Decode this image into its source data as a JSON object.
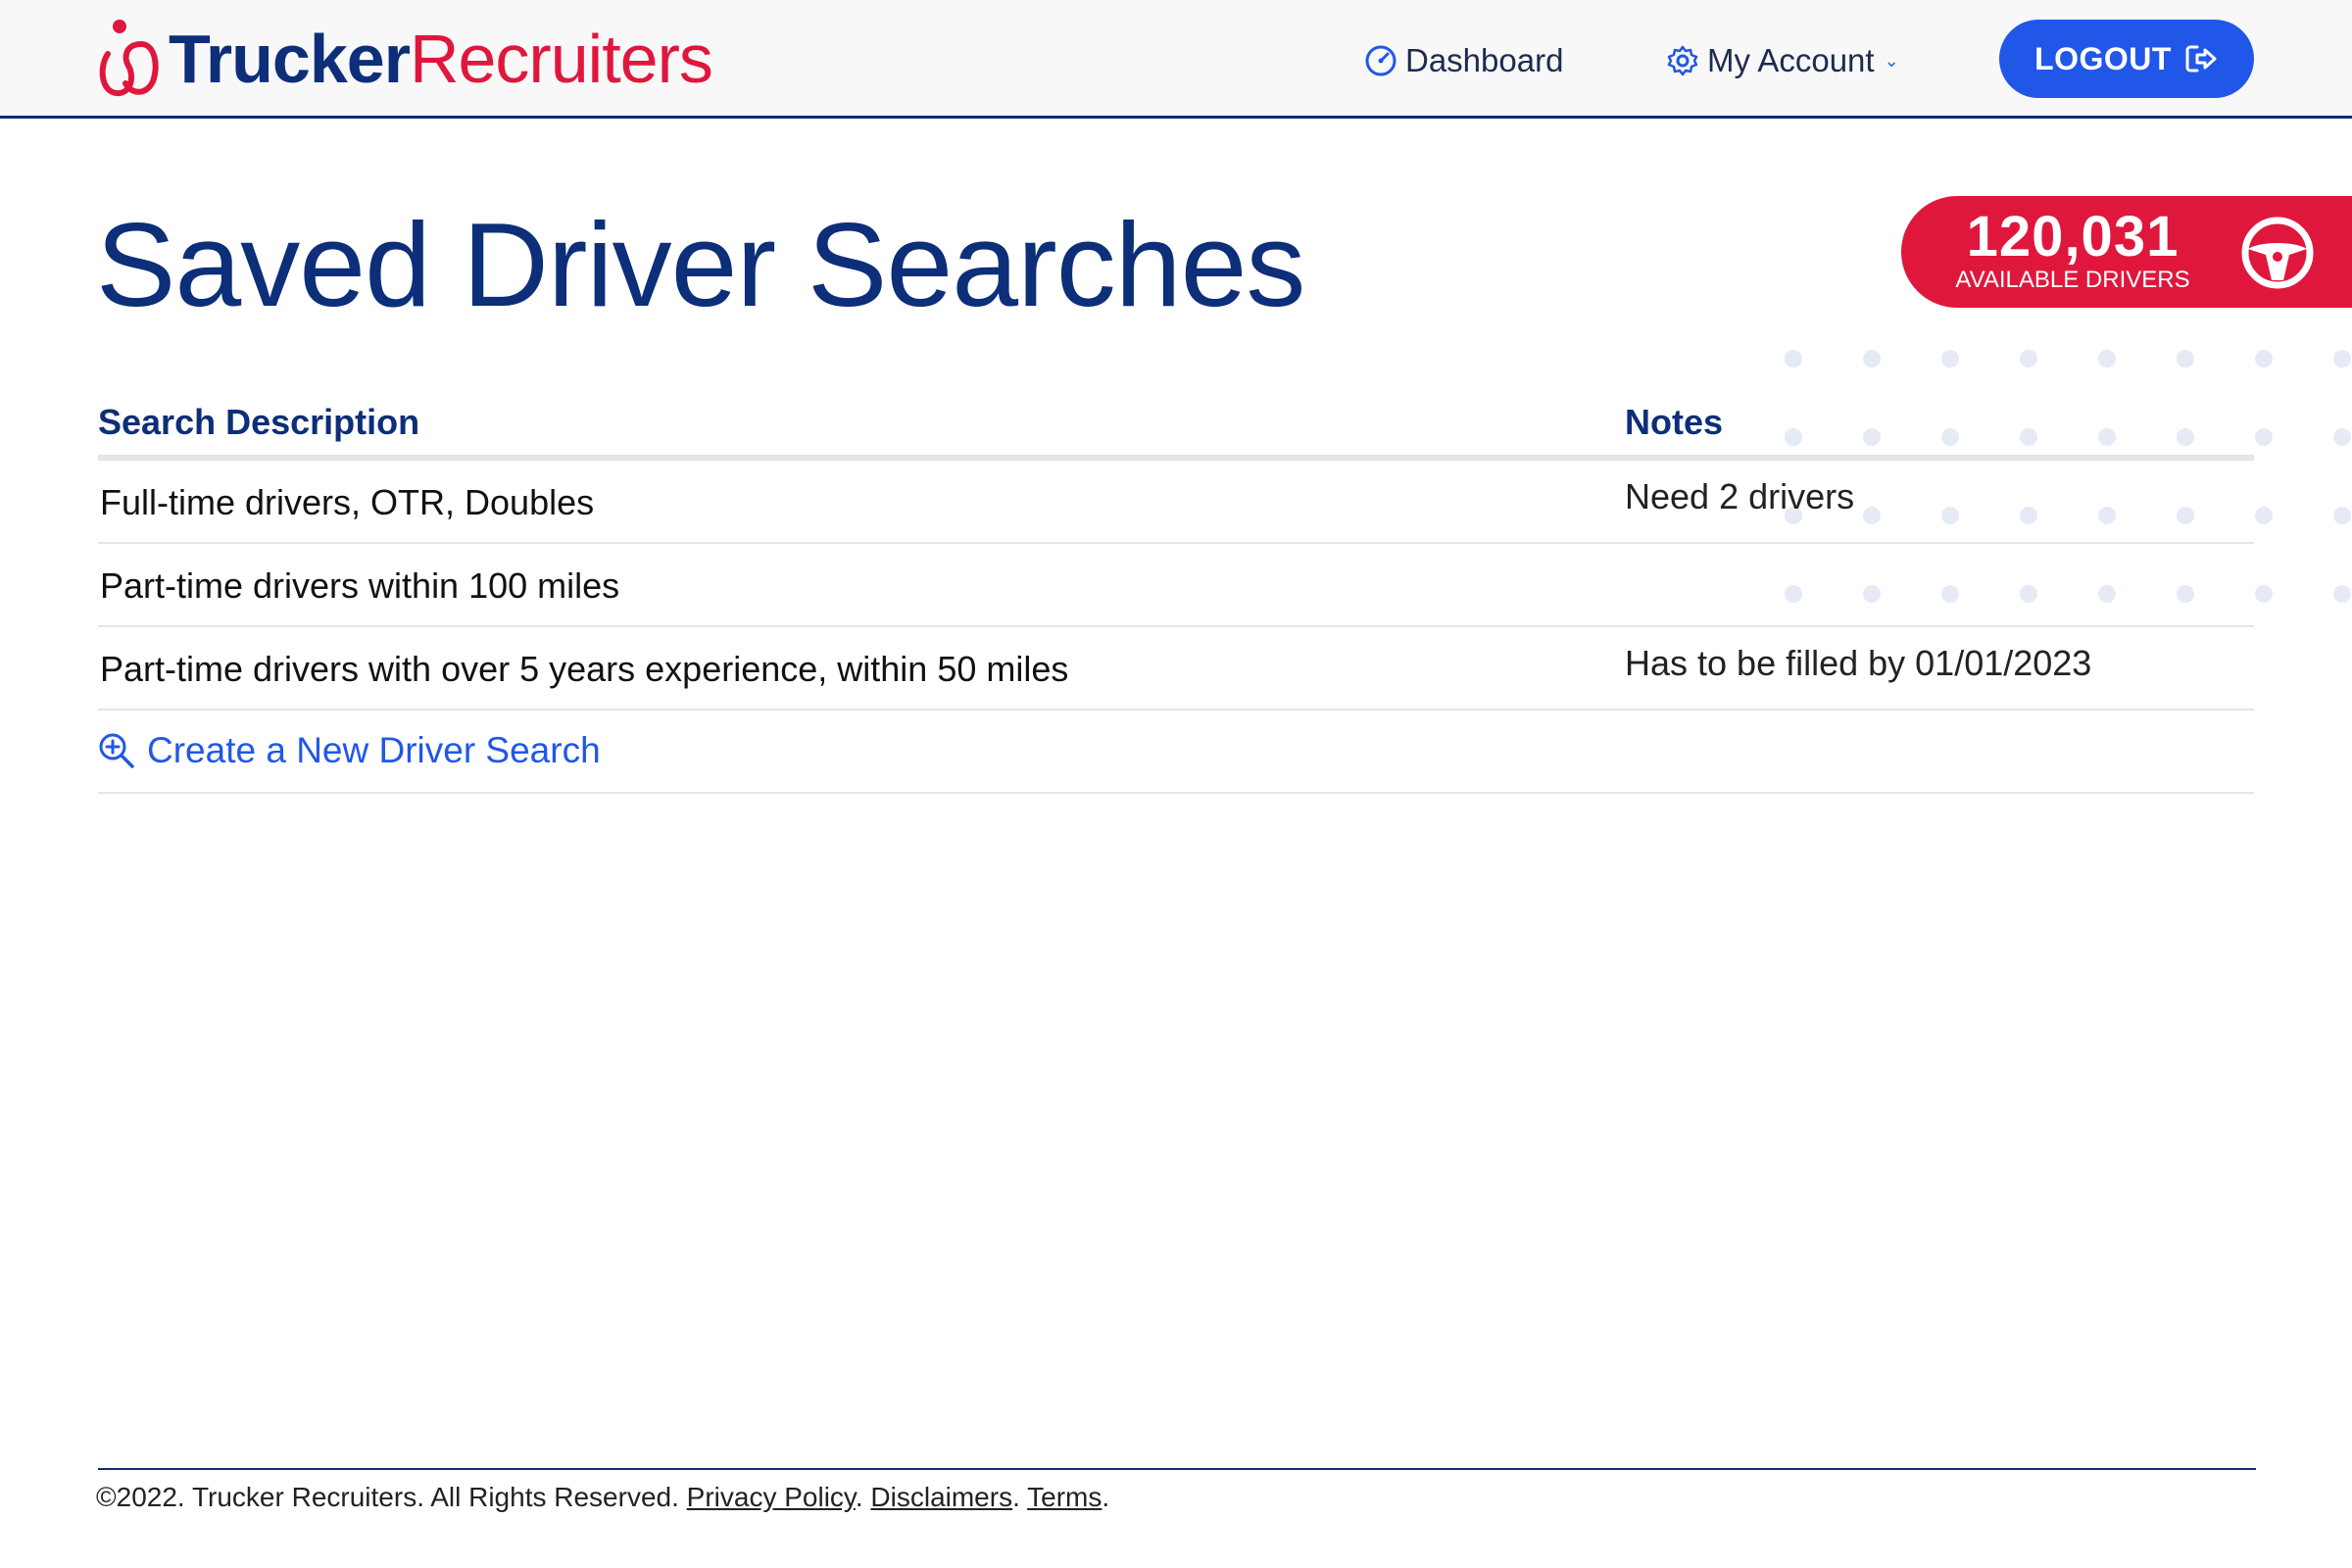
{
  "brand": {
    "name_part1": "Trucker",
    "name_part2": "Recruiters",
    "primary": "#0d2e78",
    "accent": "#e0173d",
    "button": "#2157e8"
  },
  "nav": {
    "dashboard": {
      "label": "Dashboard",
      "icon": "gauge-icon"
    },
    "account": {
      "label": "My Account",
      "icon": "gear-icon"
    },
    "logout": {
      "label": "LOGOUT",
      "icon": "logout-icon"
    }
  },
  "badge": {
    "count": "120,031",
    "label": "AVAILABLE DRIVERS",
    "icon": "steering-wheel-icon"
  },
  "page": {
    "title": "Saved Driver Searches"
  },
  "table": {
    "headers": {
      "description": "Search Description",
      "notes": "Notes"
    },
    "rows": [
      {
        "description": "Full-time drivers, OTR, Doubles",
        "notes": "Need 2 drivers"
      },
      {
        "description": "Part-time drivers within 100 miles",
        "notes": ""
      },
      {
        "description": "Part-time drivers with over 5 years experience, within 50 miles",
        "notes": "Has to be filled by 01/01/2023"
      }
    ],
    "create_label": "Create a New Driver Search"
  },
  "footer": {
    "copyright": "©2022. Trucker Recruiters. All Rights Reserved.",
    "privacy": "Privacy Policy",
    "disclaimers": "Disclaimers",
    "terms": "Terms",
    "sep1": ".",
    "sep2": ".",
    "sep3": "."
  }
}
